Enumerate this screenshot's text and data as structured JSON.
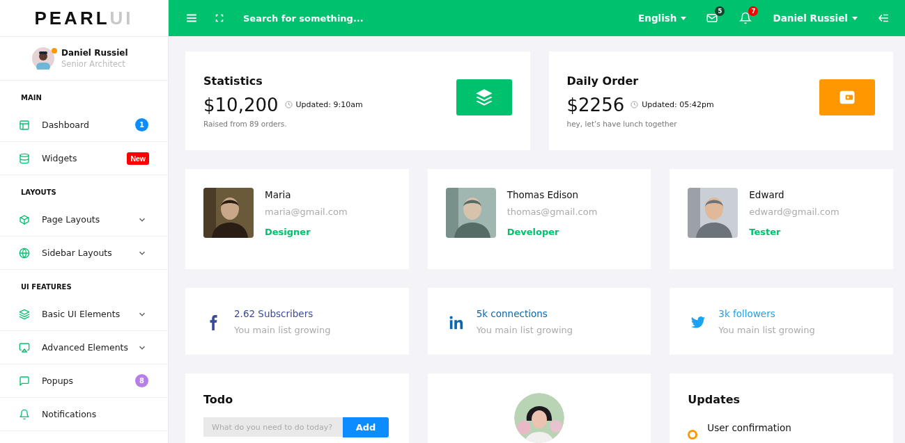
{
  "logo": {
    "main": "PEARL",
    "accent": "UI"
  },
  "profile": {
    "name": "Daniel Russiel",
    "role": "Senior Architect",
    "online": true
  },
  "sidebar": [
    {
      "title": "MAIN",
      "items": [
        {
          "label": "Dashboard",
          "badge": {
            "text": "1",
            "color": "#0d8cff"
          },
          "expandable": false
        },
        {
          "label": "Widgets",
          "badge": {
            "text": "New",
            "color": "#ff0000"
          },
          "expandable": false
        }
      ]
    },
    {
      "title": "LAYOUTS",
      "items": [
        {
          "label": "Page Layouts",
          "expandable": true
        },
        {
          "label": "Sidebar Layouts",
          "expandable": true
        }
      ]
    },
    {
      "title": "UI FEATURES",
      "items": [
        {
          "label": "Basic UI Elements",
          "expandable": true
        },
        {
          "label": "Advanced Elements",
          "expandable": true
        },
        {
          "label": "Popups",
          "badge": {
            "text": "8",
            "color": "#b57ee8"
          },
          "expandable": false
        },
        {
          "label": "Notifications",
          "expandable": false
        }
      ]
    }
  ],
  "header": {
    "search_placeholder": "Search for something...",
    "language": "English",
    "mail_count": "5",
    "notification_count": "7",
    "user": "Daniel Russiel"
  },
  "stats": [
    {
      "title": "Statistics",
      "amount": "$10,200",
      "updated": "Updated: 9:10am",
      "note": "Raised from 89 orders.",
      "kind": "layers",
      "color": "#00c16e"
    },
    {
      "title": "Daily Order",
      "amount": "$2256",
      "updated": "Updated: 05:42pm",
      "note": "hey, let’s have lunch together",
      "kind": "wallet",
      "color": "#ff9800"
    }
  ],
  "people": [
    {
      "name": "Maria",
      "email": "maria@gmail.com",
      "role": "Designer"
    },
    {
      "name": "Thomas Edison",
      "email": "thomas@gmail.com",
      "role": "Developer"
    },
    {
      "name": "Edward",
      "email": "edward@gmail.com",
      "role": "Tester"
    }
  ],
  "social": [
    {
      "kind": "facebook",
      "count": "2.62 Subscribers",
      "note": "You main list growing",
      "color": "#3b4a9a"
    },
    {
      "kind": "linkedin",
      "count": "5k connections",
      "note": "You main list growing",
      "color": "#0a66b0"
    },
    {
      "kind": "twitter",
      "count": "3k followers",
      "note": "You main list growing",
      "color": "#1da1f2"
    }
  ],
  "todo": {
    "title": "Todo",
    "placeholder": "What do you need to do today?",
    "button": "Add"
  },
  "updates": {
    "title": "Updates",
    "items": [
      {
        "title": "User confirmation",
        "color": "#ff9800"
      }
    ]
  }
}
